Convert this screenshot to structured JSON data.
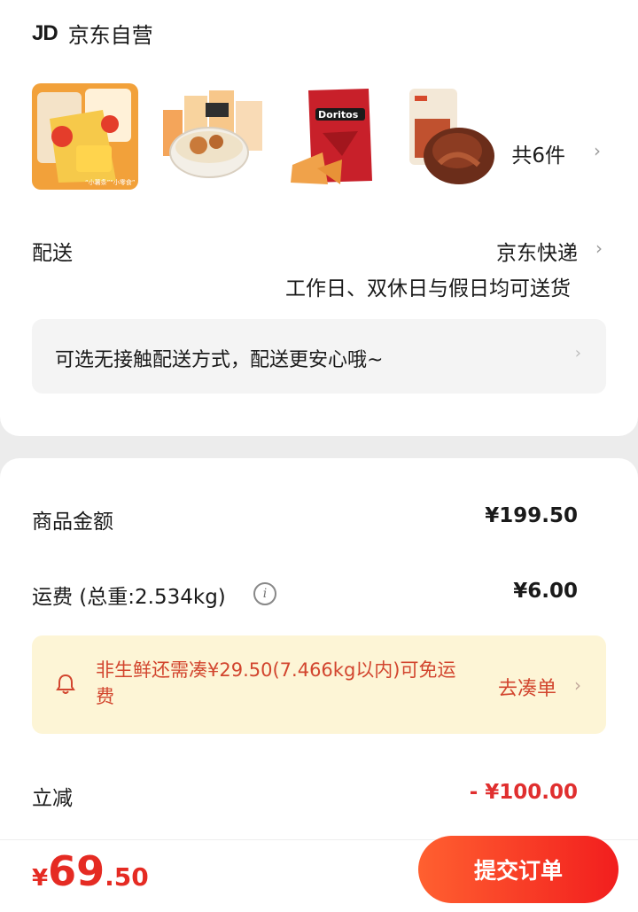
{
  "shop": {
    "logo": "JD",
    "name": "京东自营"
  },
  "items": {
    "thumbnails": [
      {
        "name": "lays-chips-pack"
      },
      {
        "name": "ramen-bowl"
      },
      {
        "name": "doritos-bag",
        "brand": "Doritos"
      },
      {
        "name": "braised-meat-snack"
      }
    ],
    "count_label": "共6件"
  },
  "delivery": {
    "label": "配送",
    "method": "京东快递",
    "schedule": "工作日、双休日与假日均可送货"
  },
  "contactless": {
    "text": "可选无接触配送方式，配送更安心哦~"
  },
  "price": {
    "goods_label": "商品金额",
    "goods_value": "¥199.50",
    "shipping_label": "运费 (总重:2.534kg)",
    "shipping_value": "¥6.00",
    "discount_label": "立减",
    "discount_value": "- ¥100.00"
  },
  "free_shipping_notice": {
    "text": "非生鲜还需凑¥29.50(7.466kg以内)可免运费",
    "action": "去凑单"
  },
  "footer": {
    "currency": "¥",
    "total_int": "69",
    "total_dec": ".50",
    "submit_label": "提交订单"
  },
  "colors": {
    "accent": "#e52b23",
    "notice_bg": "#fdf5d6",
    "button_start": "#ff6030",
    "button_end": "#f21e1e"
  }
}
